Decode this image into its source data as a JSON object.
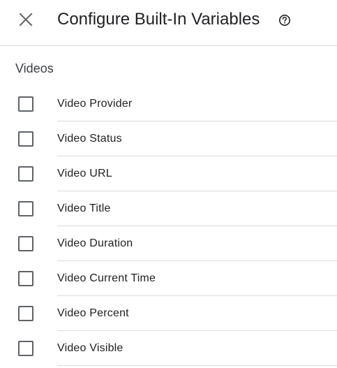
{
  "header": {
    "close_icon": "close-icon",
    "title": "Configure Built-In Variables",
    "help_icon": "help-circle-icon"
  },
  "section": {
    "title": "Videos"
  },
  "variables": [
    {
      "label": "Video Provider",
      "checked": false
    },
    {
      "label": "Video Status",
      "checked": false
    },
    {
      "label": "Video URL",
      "checked": false
    },
    {
      "label": "Video Title",
      "checked": false
    },
    {
      "label": "Video Duration",
      "checked": false
    },
    {
      "label": "Video Current Time",
      "checked": false
    },
    {
      "label": "Video Percent",
      "checked": false
    },
    {
      "label": "Video Visible",
      "checked": false
    }
  ],
  "colors": {
    "text": "#202124",
    "icon": "#5f6368",
    "divider": "#dadce0"
  }
}
